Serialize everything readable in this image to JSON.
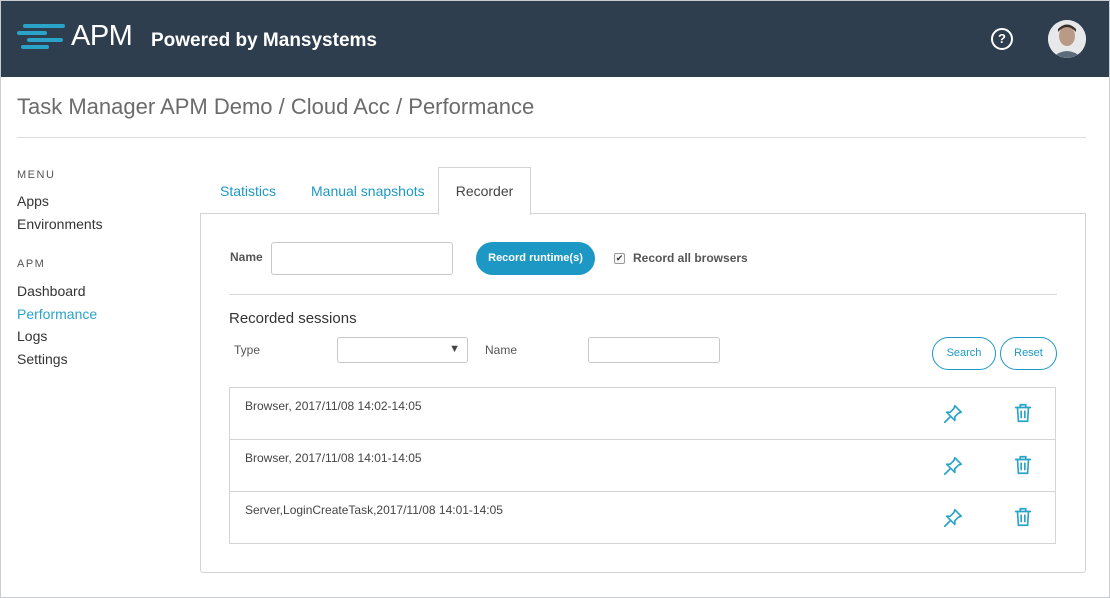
{
  "header": {
    "brand": "APM",
    "tagline": "Powered by Mansystems",
    "help_icon": "question-circle-icon",
    "avatar_icon": "user-avatar",
    "bg_color": "#2e3e4f"
  },
  "breadcrumb": "Task Manager APM Demo / Cloud Acc / Performance",
  "sidebar": {
    "menu_heading": "MENU",
    "menu_items": [
      {
        "label": "Apps"
      },
      {
        "label": "Environments"
      }
    ],
    "apm_heading": "APM",
    "apm_items": [
      {
        "label": "Dashboard"
      },
      {
        "label": "Performance",
        "active": true
      },
      {
        "label": "Logs"
      },
      {
        "label": "Settings"
      }
    ],
    "active_color": "#2aa3c9"
  },
  "tabs": [
    {
      "label": "Statistics"
    },
    {
      "label": "Manual snapshots"
    },
    {
      "label": "Recorder",
      "active": true
    }
  ],
  "recorder": {
    "name_label": "Name",
    "name_value": "",
    "record_button": "Record runtime(s)",
    "record_all_checked": true,
    "record_all_label": "Record all browsers",
    "accent_color": "#1d98c4"
  },
  "sessions": {
    "title": "Recorded sessions",
    "type_label": "Type",
    "type_value": "",
    "name_label": "Name",
    "name_value": "",
    "search_button": "Search",
    "reset_button": "Reset",
    "rows": [
      {
        "text": "Browser, 2017/11/08 14:02-14:05"
      },
      {
        "text": "Browser, 2017/11/08 14:01-14:05"
      },
      {
        "text": "Server,LoginCreateTask,2017/11/08 14:01-14:05"
      }
    ],
    "row_icons": [
      "pin-icon",
      "trash-icon"
    ]
  }
}
